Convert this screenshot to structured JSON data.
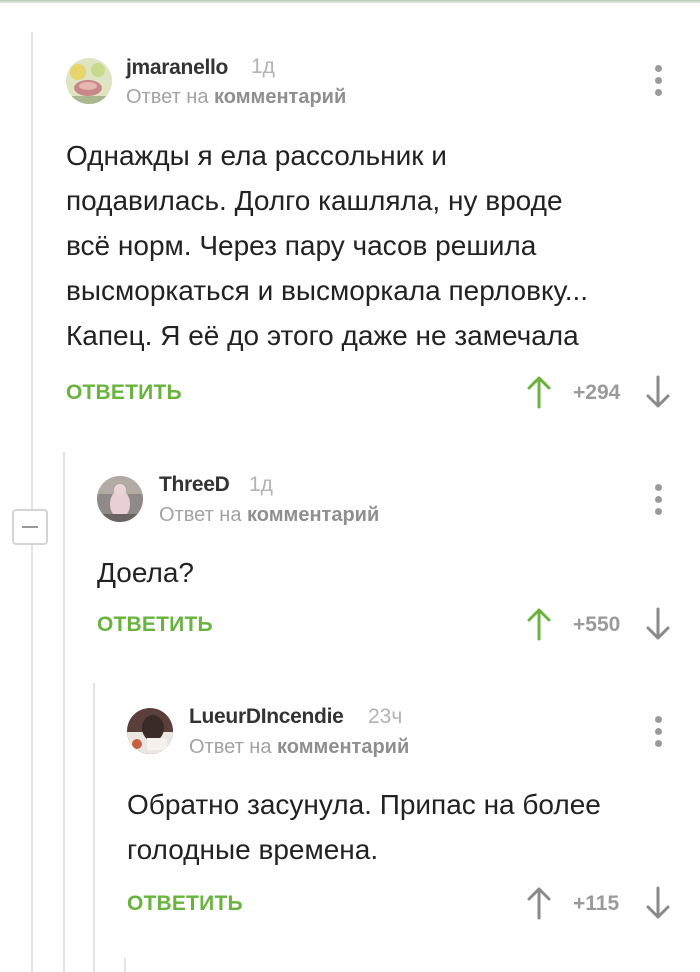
{
  "comments": [
    {
      "username": "jmaranello",
      "time": "1д",
      "reply_prefix": "Ответ на",
      "reply_target": "комментарий",
      "text_lines": [
        "Однажды я ела рассольник и",
        "подавилась. Долго кашляла, ну вроде",
        "всё норм. Через пару часов решила",
        "высморкаться и высморкала перловку...",
        "Капец. Я её до этого даже не замечала"
      ],
      "reply_label": "ОТВЕТИТЬ",
      "score": "+294",
      "upvote_color": "#69b33f"
    },
    {
      "username": "ThreeD",
      "time": "1д",
      "reply_prefix": "Ответ на",
      "reply_target": "комментарий",
      "text_lines": [
        "Доела?"
      ],
      "reply_label": "ОТВЕТИТЬ",
      "score": "+550",
      "upvote_color": "#69b33f"
    },
    {
      "username": "LueurDIncendie",
      "time": "23ч",
      "reply_prefix": "Ответ на",
      "reply_target": "комментарий",
      "text_lines": [
        "Обратно засунула. Припас на более",
        "голодные времена."
      ],
      "reply_label": "ОТВЕТИТЬ",
      "score": "+115",
      "upvote_color": "#8a8a8a"
    }
  ],
  "colors": {
    "accent_green": "#69b33f",
    "muted_gray": "#9a9a9a",
    "text": "#222222"
  },
  "icons": [
    "more-vertical-icon",
    "upvote-arrow-icon",
    "downvote-arrow-icon",
    "collapse-minus-icon"
  ]
}
